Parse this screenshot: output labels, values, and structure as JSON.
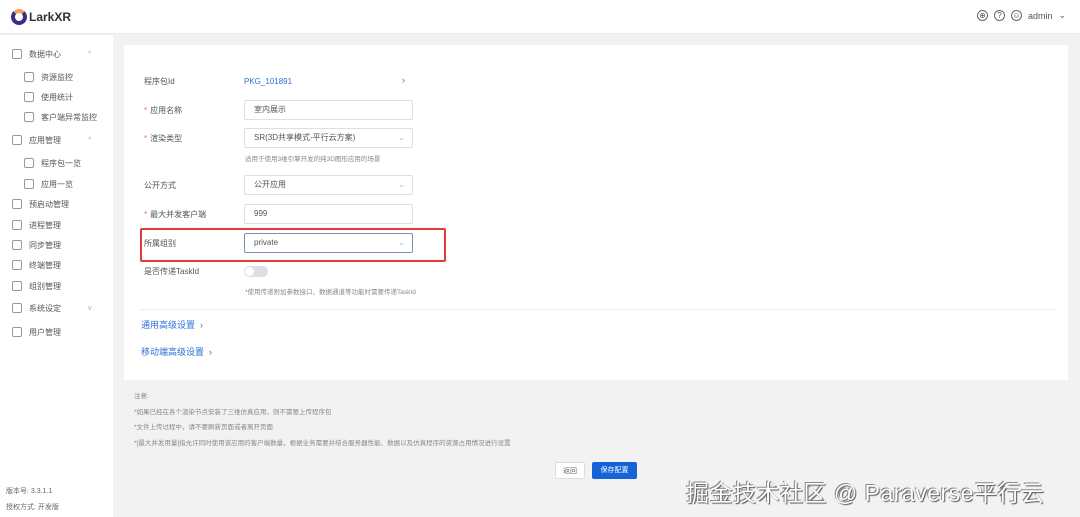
{
  "header": {
    "brand": "LarkXR",
    "user": "admin"
  },
  "sidebar": {
    "items": [
      {
        "label": "数据中心",
        "sub": false,
        "chev": "^"
      },
      {
        "label": "资源监控",
        "sub": true
      },
      {
        "label": "使用统计",
        "sub": true
      },
      {
        "label": "客户端异常监控",
        "sub": true
      },
      {
        "label": "应用管理",
        "sub": false,
        "chev": "^"
      },
      {
        "label": "程序包一览",
        "sub": true
      },
      {
        "label": "应用一览",
        "sub": true
      },
      {
        "label": "预启动管理",
        "sub": false
      },
      {
        "label": "进程管理",
        "sub": false
      },
      {
        "label": "同步管理",
        "sub": false
      },
      {
        "label": "终端管理",
        "sub": false
      },
      {
        "label": "组别管理",
        "sub": false
      },
      {
        "label": "系统设定",
        "sub": false,
        "chev": "v"
      },
      {
        "label": "用户管理",
        "sub": false
      }
    ],
    "version": "版本号: 3.3.1.1",
    "license": "授权方式: 开发版"
  },
  "form": {
    "package_id_label": "程序包Id",
    "package_id": "PKG_101891",
    "app_name_label": "应用名称",
    "app_name": "室内展示",
    "render_type_label": "渲染类型",
    "render_type": "SR(3D共享模式-平行云方案)",
    "render_hint": "适用于使用3维引擎开发的纯3D图形应用的场景",
    "public_label": "公开方式",
    "public_value": "公开应用",
    "max_clients_label": "最大并发客户端",
    "max_clients": "999",
    "group_label": "所属组别",
    "group_value": "private",
    "taskid_label": "是否传递TaskId",
    "taskid_hint": "*使用传递附加参数接口、数据通道等功能时需要传递TaskId",
    "taskid_enabled": false,
    "general_advanced": "通用高级设置",
    "mobile_advanced": "移动端高级设置"
  },
  "notes": [
    "注意:",
    "*如果已经在各个渲染节点安装了三维仿真应用，则不需要上传程序包",
    "*文件上传过程中，请不要刷新页面或者离开页面",
    "*[最大并发用量]指允许同时使用该应用的客户端数量，根据业务需要并结合服务器性能、数据以及仿真程序的资源占用情况进行设置"
  ],
  "buttons": {
    "back": "返回",
    "save": "保存配置"
  },
  "watermark": "掘金技术社区 @ Paraverse平行云"
}
